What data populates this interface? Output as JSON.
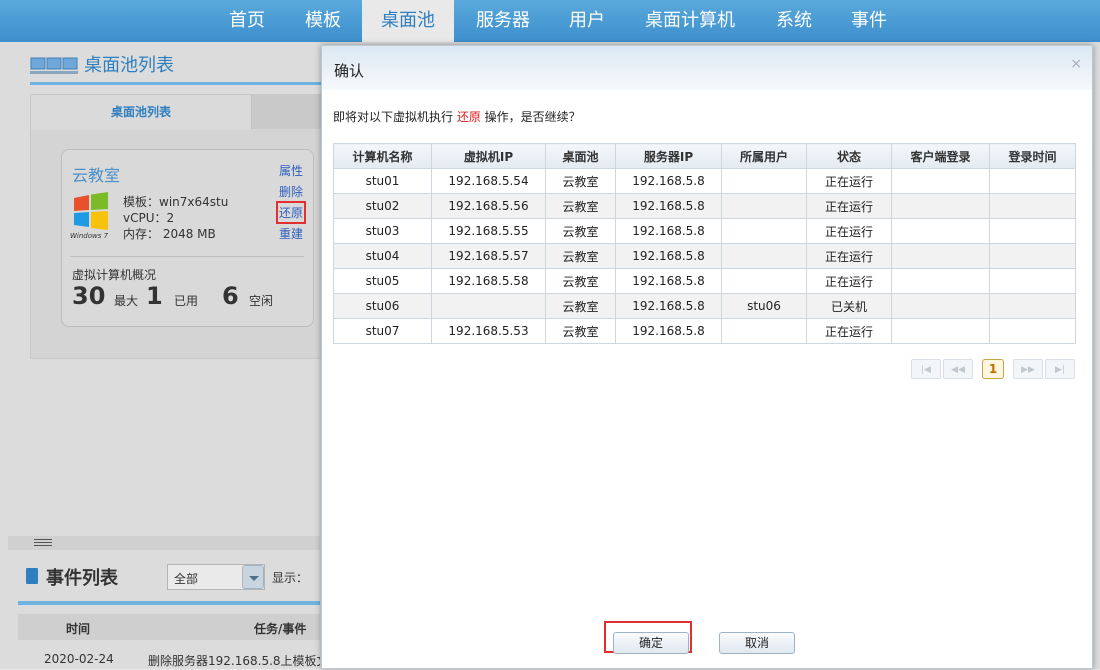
{
  "nav": {
    "items": [
      {
        "label": "首页"
      },
      {
        "label": "模板"
      },
      {
        "label": "桌面池",
        "active": true
      },
      {
        "label": "服务器"
      },
      {
        "label": "用户"
      },
      {
        "label": "桌面计算机"
      },
      {
        "label": "系统"
      },
      {
        "label": "事件"
      }
    ]
  },
  "pool_section": {
    "title": "桌面池列表",
    "tab_label": "桌面池列表",
    "card": {
      "name": "云教室",
      "logo_text": "Windows 7",
      "template": "模板：win7x64stu",
      "vcpu": "vCPU：2",
      "memory": "内存： 2048 MB",
      "actions": [
        "属性",
        "删除",
        "还原",
        "重建"
      ],
      "overview_label": "虚拟计算机概况",
      "max_value": "30",
      "max_label": "最大",
      "used_value": "1",
      "used_label": "已用",
      "idle_value": "6",
      "idle_label": "空闲"
    }
  },
  "events": {
    "title": "事件列表",
    "filter_value": "全部",
    "show_label": "显示：",
    "columns": [
      "时间",
      "任务/事件"
    ],
    "rows": [
      {
        "time": "2020-02-24",
        "task": "删除服务器192.168.5.8上模板文"
      }
    ]
  },
  "modal": {
    "title": "确认",
    "close_icon": "×",
    "message_prefix": "即将对以下虚拟机执行 ",
    "message_action": "还原",
    "message_suffix": " 操作，是否继续？",
    "columns": [
      "计算机名称",
      "虚拟机IP",
      "桌面池",
      "服务器IP",
      "所属用户",
      "状态",
      "客户端登录",
      "登录时间"
    ],
    "rows": [
      {
        "name": "stu01",
        "ip": "192.168.5.54",
        "pool": "云教室",
        "server": "192.168.5.8",
        "user": "",
        "status": "正在运行",
        "running": true
      },
      {
        "name": "stu02",
        "ip": "192.168.5.56",
        "pool": "云教室",
        "server": "192.168.5.8",
        "user": "",
        "status": "正在运行",
        "running": true
      },
      {
        "name": "stu03",
        "ip": "192.168.5.55",
        "pool": "云教室",
        "server": "192.168.5.8",
        "user": "",
        "status": "正在运行",
        "running": true
      },
      {
        "name": "stu04",
        "ip": "192.168.5.57",
        "pool": "云教室",
        "server": "192.168.5.8",
        "user": "",
        "status": "正在运行",
        "running": true
      },
      {
        "name": "stu05",
        "ip": "192.168.5.58",
        "pool": "云教室",
        "server": "192.168.5.8",
        "user": "",
        "status": "正在运行",
        "running": true
      },
      {
        "name": "stu06",
        "ip": "",
        "pool": "云教室",
        "server": "192.168.5.8",
        "user": "stu06",
        "status": "已关机",
        "running": false
      },
      {
        "name": "stu07",
        "ip": "192.168.5.53",
        "pool": "云教室",
        "server": "192.168.5.8",
        "user": "",
        "status": "正在运行",
        "running": true
      }
    ],
    "pagination": {
      "first_icon": "first-page-icon",
      "prev_icon": "prev-page-icon",
      "next_icon": "next-page-icon",
      "last_icon": "last-page-icon",
      "current_page": "1"
    },
    "ok_label": "确定",
    "cancel_label": "取消"
  },
  "colors": {
    "accent": "#2f7fc0",
    "danger": "#e02020",
    "running": "#2c8a2c"
  }
}
